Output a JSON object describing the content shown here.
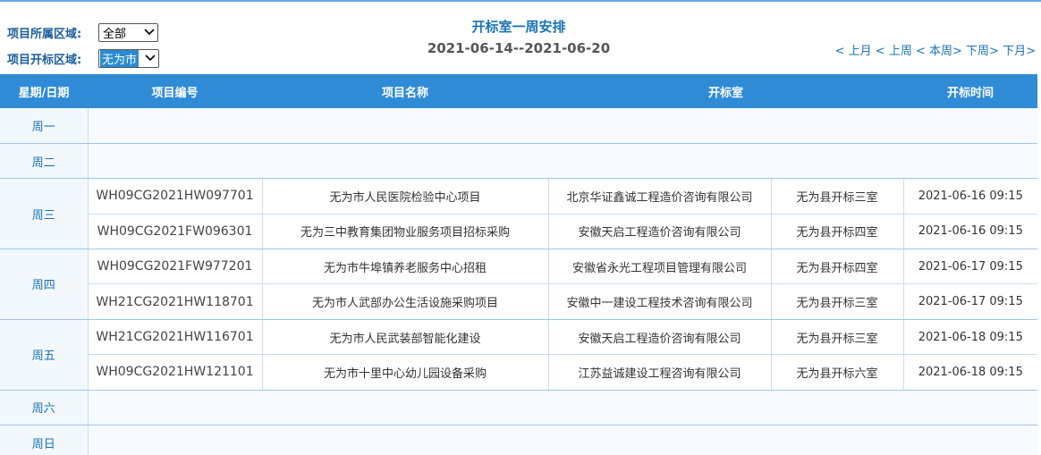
{
  "filters": {
    "region_label": "项目所属区域:",
    "region_value": "全部",
    "bid_region_label": "项目开标区域:",
    "bid_region_value": "无为市"
  },
  "title": "开标室一周安排",
  "date_range": "2021-06-14--2021-06-20",
  "nav": {
    "prev_month": "< 上月",
    "prev_week": "< 上周",
    "this_week": "< 本周>",
    "next_week": "下周>",
    "next_month": "下月>"
  },
  "table": {
    "headers": [
      "星期/日期",
      "项目编号",
      "项目名称",
      "开标室",
      "开标时间"
    ],
    "days": {
      "mon": "周一",
      "tue": "周二",
      "wed": "周三",
      "thu": "周四",
      "fri": "周五",
      "sat": "周六",
      "sun": "周日"
    },
    "rows": [
      {
        "code": "WH09CG2021HW097701",
        "name": "无为市人民医院检验中心项目",
        "agency": "北京华证鑫诚工程造价咨询有限公司",
        "room": "无为县开标三室",
        "time": "2021-06-16 09:15"
      },
      {
        "code": "WH09CG2021FW096301",
        "name": "无为三中教育集团物业服务项目招标采购",
        "agency": "安徽天启工程造价咨询有限公司",
        "room": "无为县开标四室",
        "time": "2021-06-16 09:15"
      },
      {
        "code": "WH09CG2021FW977201",
        "name": "无为市牛埠镇养老服务中心招租",
        "agency": "安徽省永光工程项目管理有限公司",
        "room": "无为县开标四室",
        "time": "2021-06-17 09:15"
      },
      {
        "code": "WH21CG2021HW118701",
        "name": "无为市人武部办公生活设施采购项目",
        "agency": "安徽中一建设工程技术咨询有限公司",
        "room": "无为县开标三室",
        "time": "2021-06-17 09:15"
      },
      {
        "code": "WH21CG2021HW116701",
        "name": "无为市人民武装部智能化建设",
        "agency": "安徽天启工程造价咨询有限公司",
        "room": "无为县开标三室",
        "time": "2021-06-18 09:15"
      },
      {
        "code": "WH09CG2021HW121101",
        "name": "无为市十里中心幼儿园设备采购",
        "agency": "江苏益诚建设工程咨询有限公司",
        "room": "无为县开标六室",
        "time": "2021-06-18 09:15"
      }
    ]
  },
  "colors": {
    "header_bg": "#2f8bd6",
    "accent": "#1a73b6"
  }
}
